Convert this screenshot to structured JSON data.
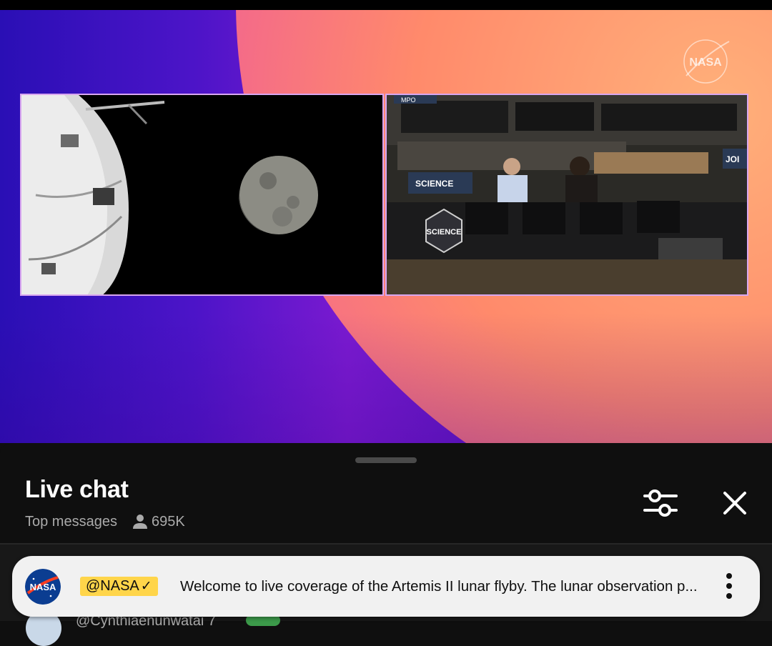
{
  "video": {
    "corner_logo_text": "NASA",
    "left_feed": "orion-spacecraft-moon-view",
    "right_feed": "mission-control-room",
    "overlay_texts": [
      "SCIENCE",
      "SCIENCE",
      "MPO",
      "JOI"
    ]
  },
  "chat": {
    "title": "Live chat",
    "mode": "Top messages",
    "viewer_count": "695K",
    "pinned": {
      "author": "@NASA",
      "verified_mark": "✓",
      "avatar_text": "NASA",
      "message": "Welcome to live coverage of the Artemis II lunar flyby. The lunar observation p..."
    },
    "next_message_preview": "@Cynthiaenunwatai  7"
  },
  "icons": {
    "filter": "sliders-icon",
    "close": "close-icon",
    "more": "more-vert-icon",
    "viewer": "person-icon"
  },
  "colors": {
    "sheet_bg": "#0f0f0f",
    "chip_yellow": "#ffd54a",
    "pinned_bg": "#f1f1f1",
    "video_purple": "#4c14c8",
    "video_orange": "#ff8a6b"
  }
}
